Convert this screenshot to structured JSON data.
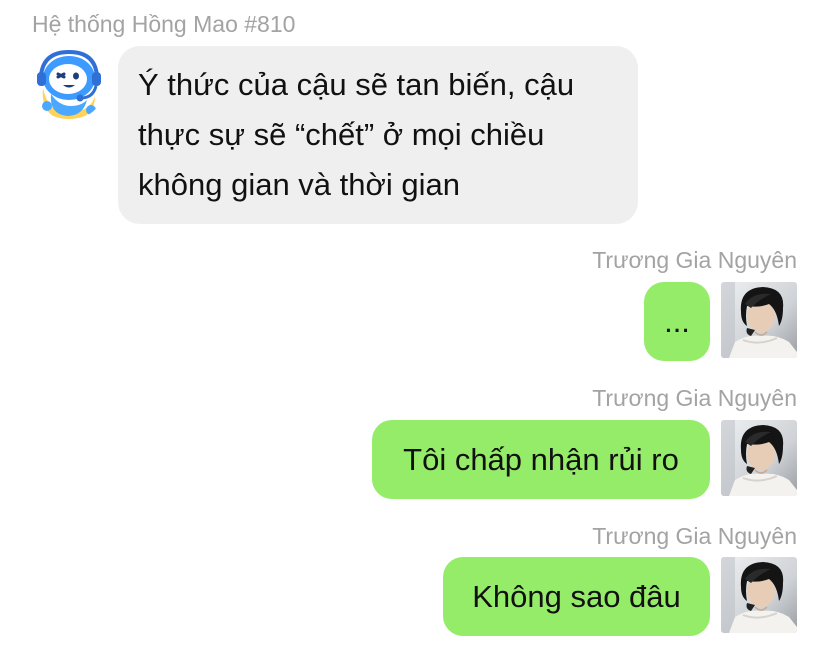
{
  "chat": {
    "bot": {
      "sender_name": "Hệ thống Hồng Mao #810",
      "avatar_icon": "robot-mascot-headset-icon",
      "message": "Ý thức của cậu sẽ tan biến, cậu thực sự sẽ “chết” ở mọi chiều không gian và thời gian"
    },
    "messages": [
      {
        "sender_name": "Trương Gia Nguyên",
        "text": "...",
        "avatar_icon": "user-portrait-avatar"
      },
      {
        "sender_name": "Trương Gia Nguyên",
        "text": "Tôi chấp nhận rủi ro",
        "avatar_icon": "user-portrait-avatar"
      },
      {
        "sender_name": "Trương Gia Nguyên",
        "text": "Không sao đâu",
        "avatar_icon": "user-portrait-avatar"
      }
    ]
  },
  "colors": {
    "outgoing_bubble": "#95ec69",
    "incoming_bubble": "#efefef",
    "sender_name": "#a3a3a3"
  }
}
